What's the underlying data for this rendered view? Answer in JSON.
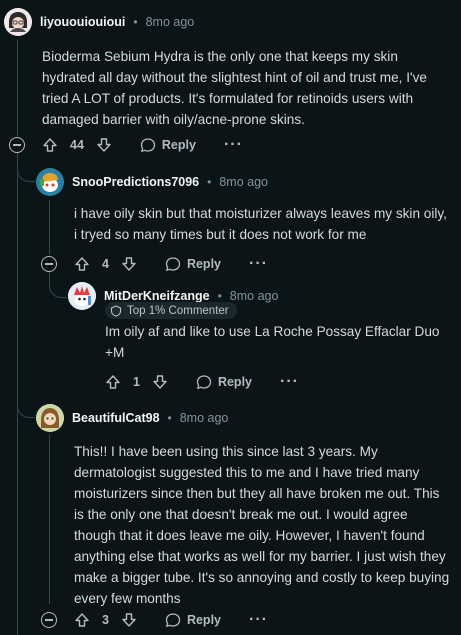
{
  "comments": [
    {
      "username": "liyououiouioui",
      "separator": "•",
      "time": "8mo ago",
      "body": "Bioderma Sebium Hydra is the only one that keeps my skin hydrated all day without the slightest hint of oil and trust me, I've tried A LOT of products. It's formulated for retinoids users with damaged barrier with oily/acne-prone skins.",
      "votes": "44",
      "reply_label": "Reply",
      "more_label": "···"
    },
    {
      "username": "SnooPredictions7096",
      "separator": "•",
      "time": "8mo ago",
      "body": "i have oily skin but that moisturizer always leaves my skin oily, i tryed so many times but it does not work for me",
      "votes": "4",
      "reply_label": "Reply",
      "more_label": "···"
    },
    {
      "username": "MitDerKneifzange",
      "separator": "•",
      "time": "8mo ago",
      "badge": "Top 1% Commenter",
      "body": "Im oily af and like to use La Roche Possay Effaclar Duo +M",
      "votes": "1",
      "reply_label": "Reply",
      "more_label": "···"
    },
    {
      "username": "BeautifulCat98",
      "separator": "•",
      "time": "8mo ago",
      "body": "This!! I have been using this since last 3 years. My dermatologist suggested this to me and I have tried many moisturizers since then but they all have broken me out. This is the only one that doesn't break me out. I would agree though that it does leave me oily. However, I haven't found anything else that works as well for my barrier. I just wish they make a bigger tube. It's so annoying and costly to keep buying every few months",
      "votes": "3",
      "reply_label": "Reply",
      "more_label": "···"
    }
  ],
  "colors": {
    "background": "#0b1416",
    "thread_line": "#33464c",
    "text": "#d7dadc",
    "meta": "#82959b"
  },
  "icons": [
    "upvote-icon",
    "downvote-icon",
    "comment-bubble-icon",
    "collapse-icon",
    "badge-icon"
  ]
}
